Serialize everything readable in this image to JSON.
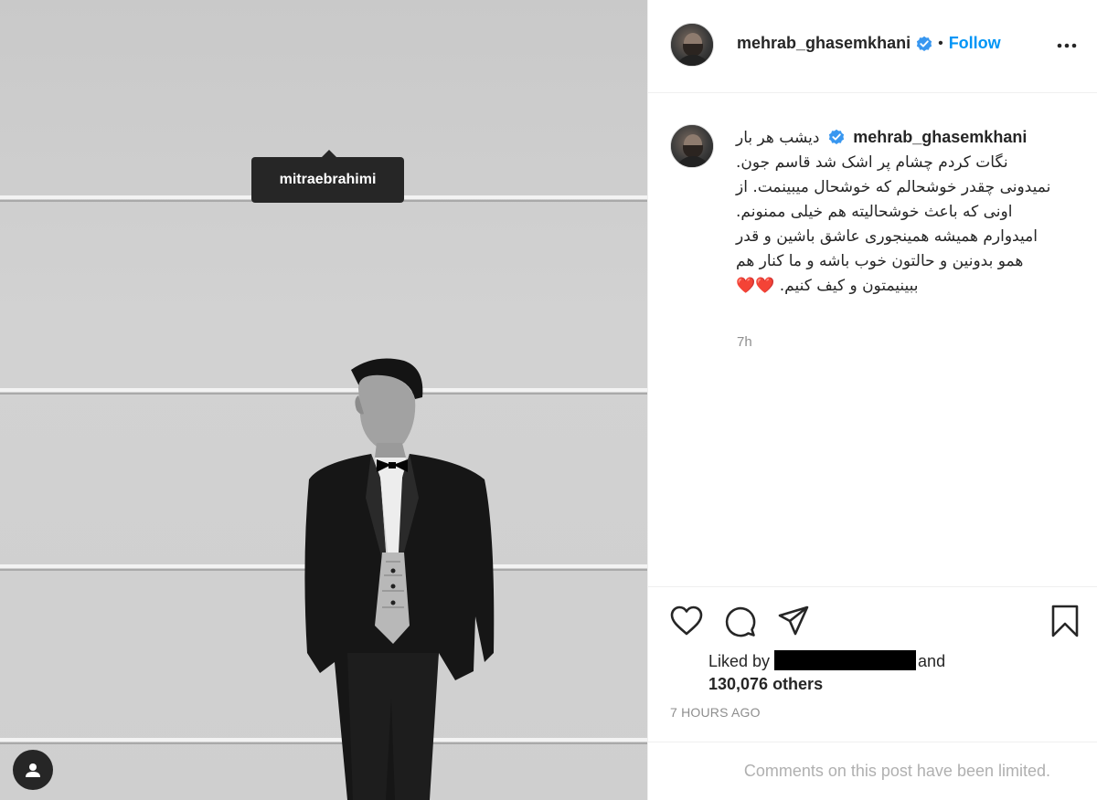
{
  "post": {
    "author": "mehrab_ghasemkhani",
    "follow_label": "Follow",
    "separator": "•",
    "tagged_user": "mitraebrahimi",
    "caption": "دیشب هر بار نگات کردم چشام پر اشک شد قاسم جون. نمیدونی چقدر خوشحالم که خوشحال میبینمت. از اونی که باعث خوشحالیته هم خیلی ممنونم. امیدوارم همیشه همینجوری عاشق باشین و قدر همو بدونین و حالتون خوب باشه و ما کنار هم ببینیمتون و کیف کنیم.",
    "caption_emoji": "❤️❤️",
    "caption_time": "7h",
    "liked_by_prefix": "Liked by",
    "liked_by_suffix": "and",
    "likes_count": "130,076 others",
    "timestamp": "7 HOURS AGO",
    "comments_notice": "Comments on this post have been limited."
  },
  "colors": {
    "accent": "#0095f6",
    "verified": "#3897f0",
    "heart": "#ed4956",
    "text": "#262626",
    "muted": "#8e8e8e"
  },
  "icons": [
    "user-tag-icon",
    "verified-badge-icon",
    "more-options-icon",
    "heart-icon",
    "comment-icon",
    "share-icon",
    "bookmark-icon"
  ]
}
